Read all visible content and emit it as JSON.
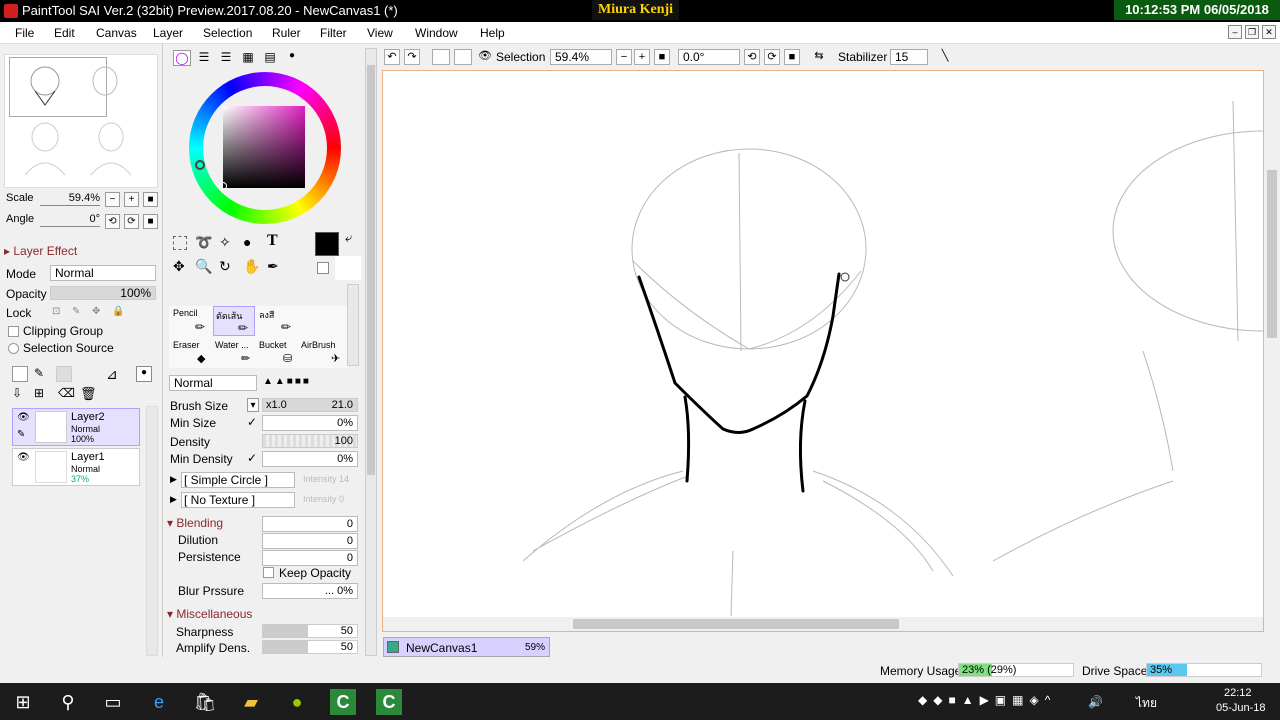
{
  "titlebar": {
    "title": "PaintTool SAI Ver.2 (32bit) Preview.2017.08.20 - NewCanvas1 (*)",
    "author": "Miura Kenji",
    "clock": "10:12:53 PM 06/05/2018"
  },
  "menu": [
    "File",
    "Edit",
    "Canvas",
    "Layer",
    "Selection",
    "Ruler",
    "Filter",
    "View",
    "Window",
    "Help"
  ],
  "toolbar": {
    "selection_label": "Selection",
    "zoom": "59.4%",
    "rotation": "0.0°",
    "stabilizer_label": "Stabilizer",
    "stabilizer_value": "15"
  },
  "navigator": {
    "scale_label": "Scale",
    "scale_value": "59.4%",
    "angle_label": "Angle",
    "angle_value": "0°"
  },
  "layer_panel": {
    "effect_label": "Layer Effect",
    "mode_label": "Mode",
    "mode_value": "Normal",
    "opacity_label": "Opacity",
    "opacity_value": "100%",
    "lock_label": "Lock",
    "clipping_label": "Clipping Group",
    "selection_source_label": "Selection Source",
    "layers": [
      {
        "name": "Layer2",
        "mode": "Normal",
        "opacity": "100%"
      },
      {
        "name": "Layer1",
        "mode": "Normal",
        "opacity": "37%"
      }
    ]
  },
  "tools": {
    "row1": [
      "Pencil",
      "ตัดเส้น",
      "ลงสี"
    ],
    "row2": [
      "Eraser",
      "Water ...",
      "Bucket",
      "AirBrush"
    ]
  },
  "brush": {
    "mode": "Normal",
    "size_label": "Brush Size",
    "size_mult": "x1.0",
    "size_value": "21.0",
    "minsize_label": "Min Size",
    "minsize_value": "0%",
    "density_label": "Density",
    "density_value": "100",
    "mindensity_label": "Min Density",
    "mindensity_value": "0%",
    "shape": "[ Simple Circle ]",
    "shape_intensity": "Intensity 14",
    "texture": "[ No Texture ]",
    "texture_intensity": "Intensity 0",
    "blending_label": "Blending",
    "blending_value": "0",
    "dilution_label": "Dilution",
    "dilution_value": "0",
    "persistence_label": "Persistence",
    "persistence_value": "0",
    "keep_opacity_label": "Keep Opacity",
    "blur_label": "Blur Prssure",
    "blur_value": "... 0%",
    "misc_label": "Miscellaneous",
    "sharpness_label": "Sharpness",
    "sharpness_value": "50",
    "amplify_label": "Amplify Dens.",
    "amplify_value": "50"
  },
  "canvas_tab": {
    "name": "NewCanvas1",
    "zoom": "59%"
  },
  "status": {
    "memory_label": "Memory Usage",
    "memory_value": "23% (29%)",
    "drive_label": "Drive Space",
    "drive_value": "35%",
    "memory_fraction": 0.29,
    "drive_fraction": 0.35
  },
  "taskbar": {
    "time": "22:12",
    "date": "05-Jun-18",
    "lang": "ไทย"
  },
  "colors": {
    "current": "#000000",
    "accent": "#b0a0ff"
  }
}
